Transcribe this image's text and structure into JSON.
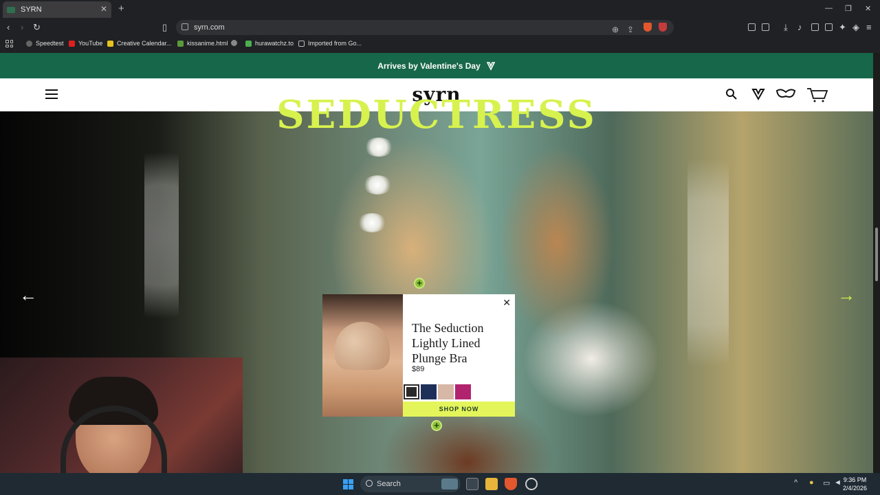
{
  "browser": {
    "tab_title": "SYRN",
    "url": "syrn.com",
    "new_tab": "+",
    "bookmarks": [
      "Speedtest",
      "YouTube",
      "Creative Calendar...",
      "kissanime.html",
      "hurawatchz.to",
      "Imported from Go..."
    ]
  },
  "site": {
    "promo_text": "Arrives by Valentine's Day",
    "logo": "syrn",
    "hero_title": "SEDUCTRESS",
    "popup": {
      "title": "The Seduction Lightly Lined Plunge Bra",
      "price": "$89",
      "cta": "SHOP NOW",
      "swatches": [
        "#2a2a2a",
        "#1e2f5a",
        "#d7b7a6",
        "#b2236f"
      ]
    },
    "colors": {
      "promo_bg": "#17674a",
      "accent": "#d7f24e",
      "cta_bg": "#e4f55c"
    }
  },
  "taskbar": {
    "search_label": "Search",
    "time": "9:36 PM",
    "date": "2/4/2026"
  },
  "icons": [
    "back-icon",
    "forward-icon",
    "reload-icon",
    "bookmark-icon",
    "search-icon",
    "heart-icon",
    "bag-icon",
    "cart-icon",
    "close-icon",
    "arrow-left-icon",
    "arrow-right-icon"
  ]
}
